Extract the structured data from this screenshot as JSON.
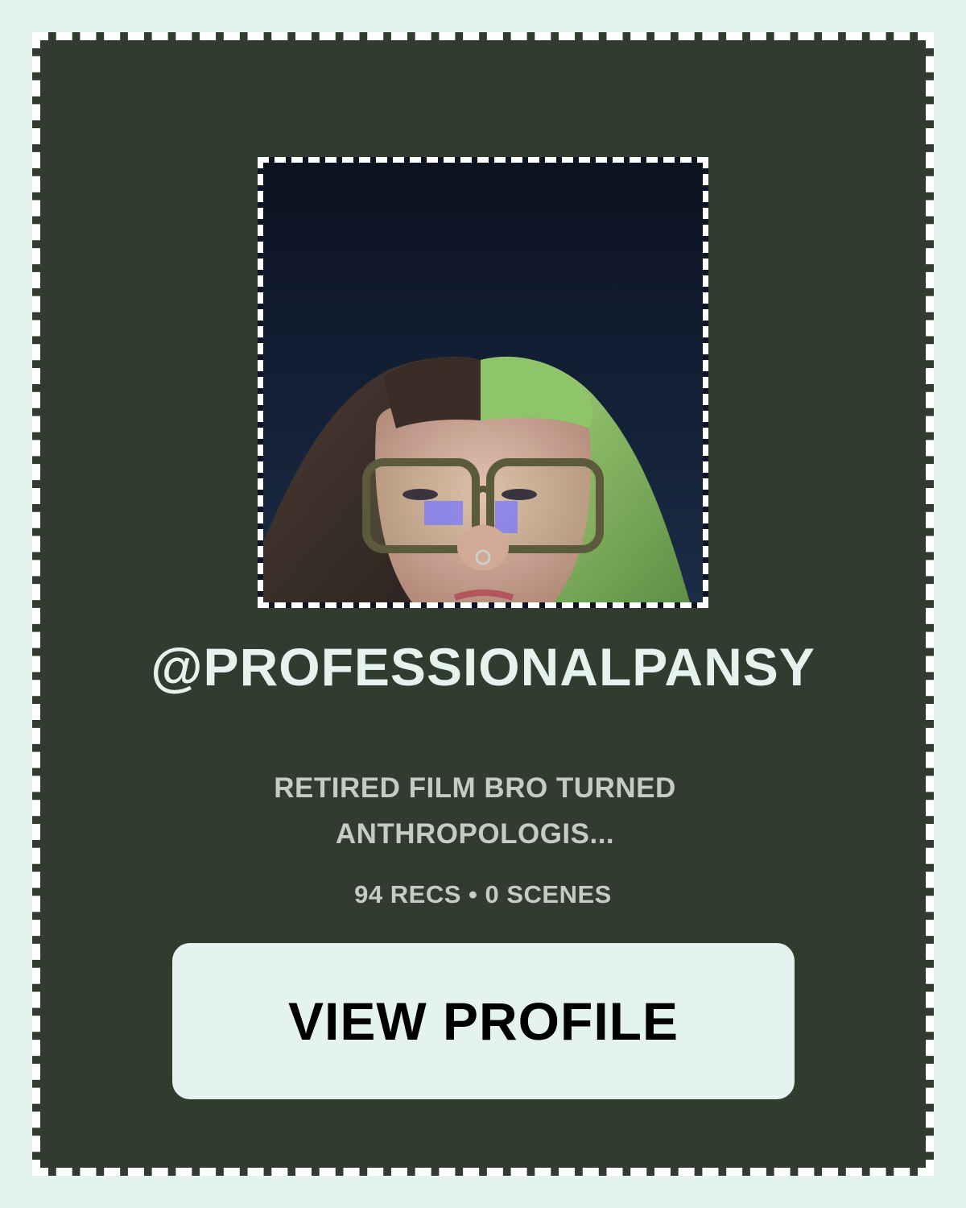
{
  "profile": {
    "photo_alt": "profile-photo",
    "handle": "@PROFESSIONALPANSY",
    "bio_line1": "RETIRED FILM BRO TURNED",
    "bio_line2": "ANTHROPOLOGIS...",
    "stats": "94 RECS • 0 SCENES"
  },
  "actions": {
    "view_profile_label": "VIEW PROFILE"
  },
  "colors": {
    "page_background": "#e5f3ef",
    "card_background": "#323b30",
    "dashed_border": "#ffffff",
    "handle_text": "#e5f3ef",
    "secondary_text": "#c7cbc4",
    "button_background": "#e5f3ef",
    "button_text": "#000000"
  }
}
